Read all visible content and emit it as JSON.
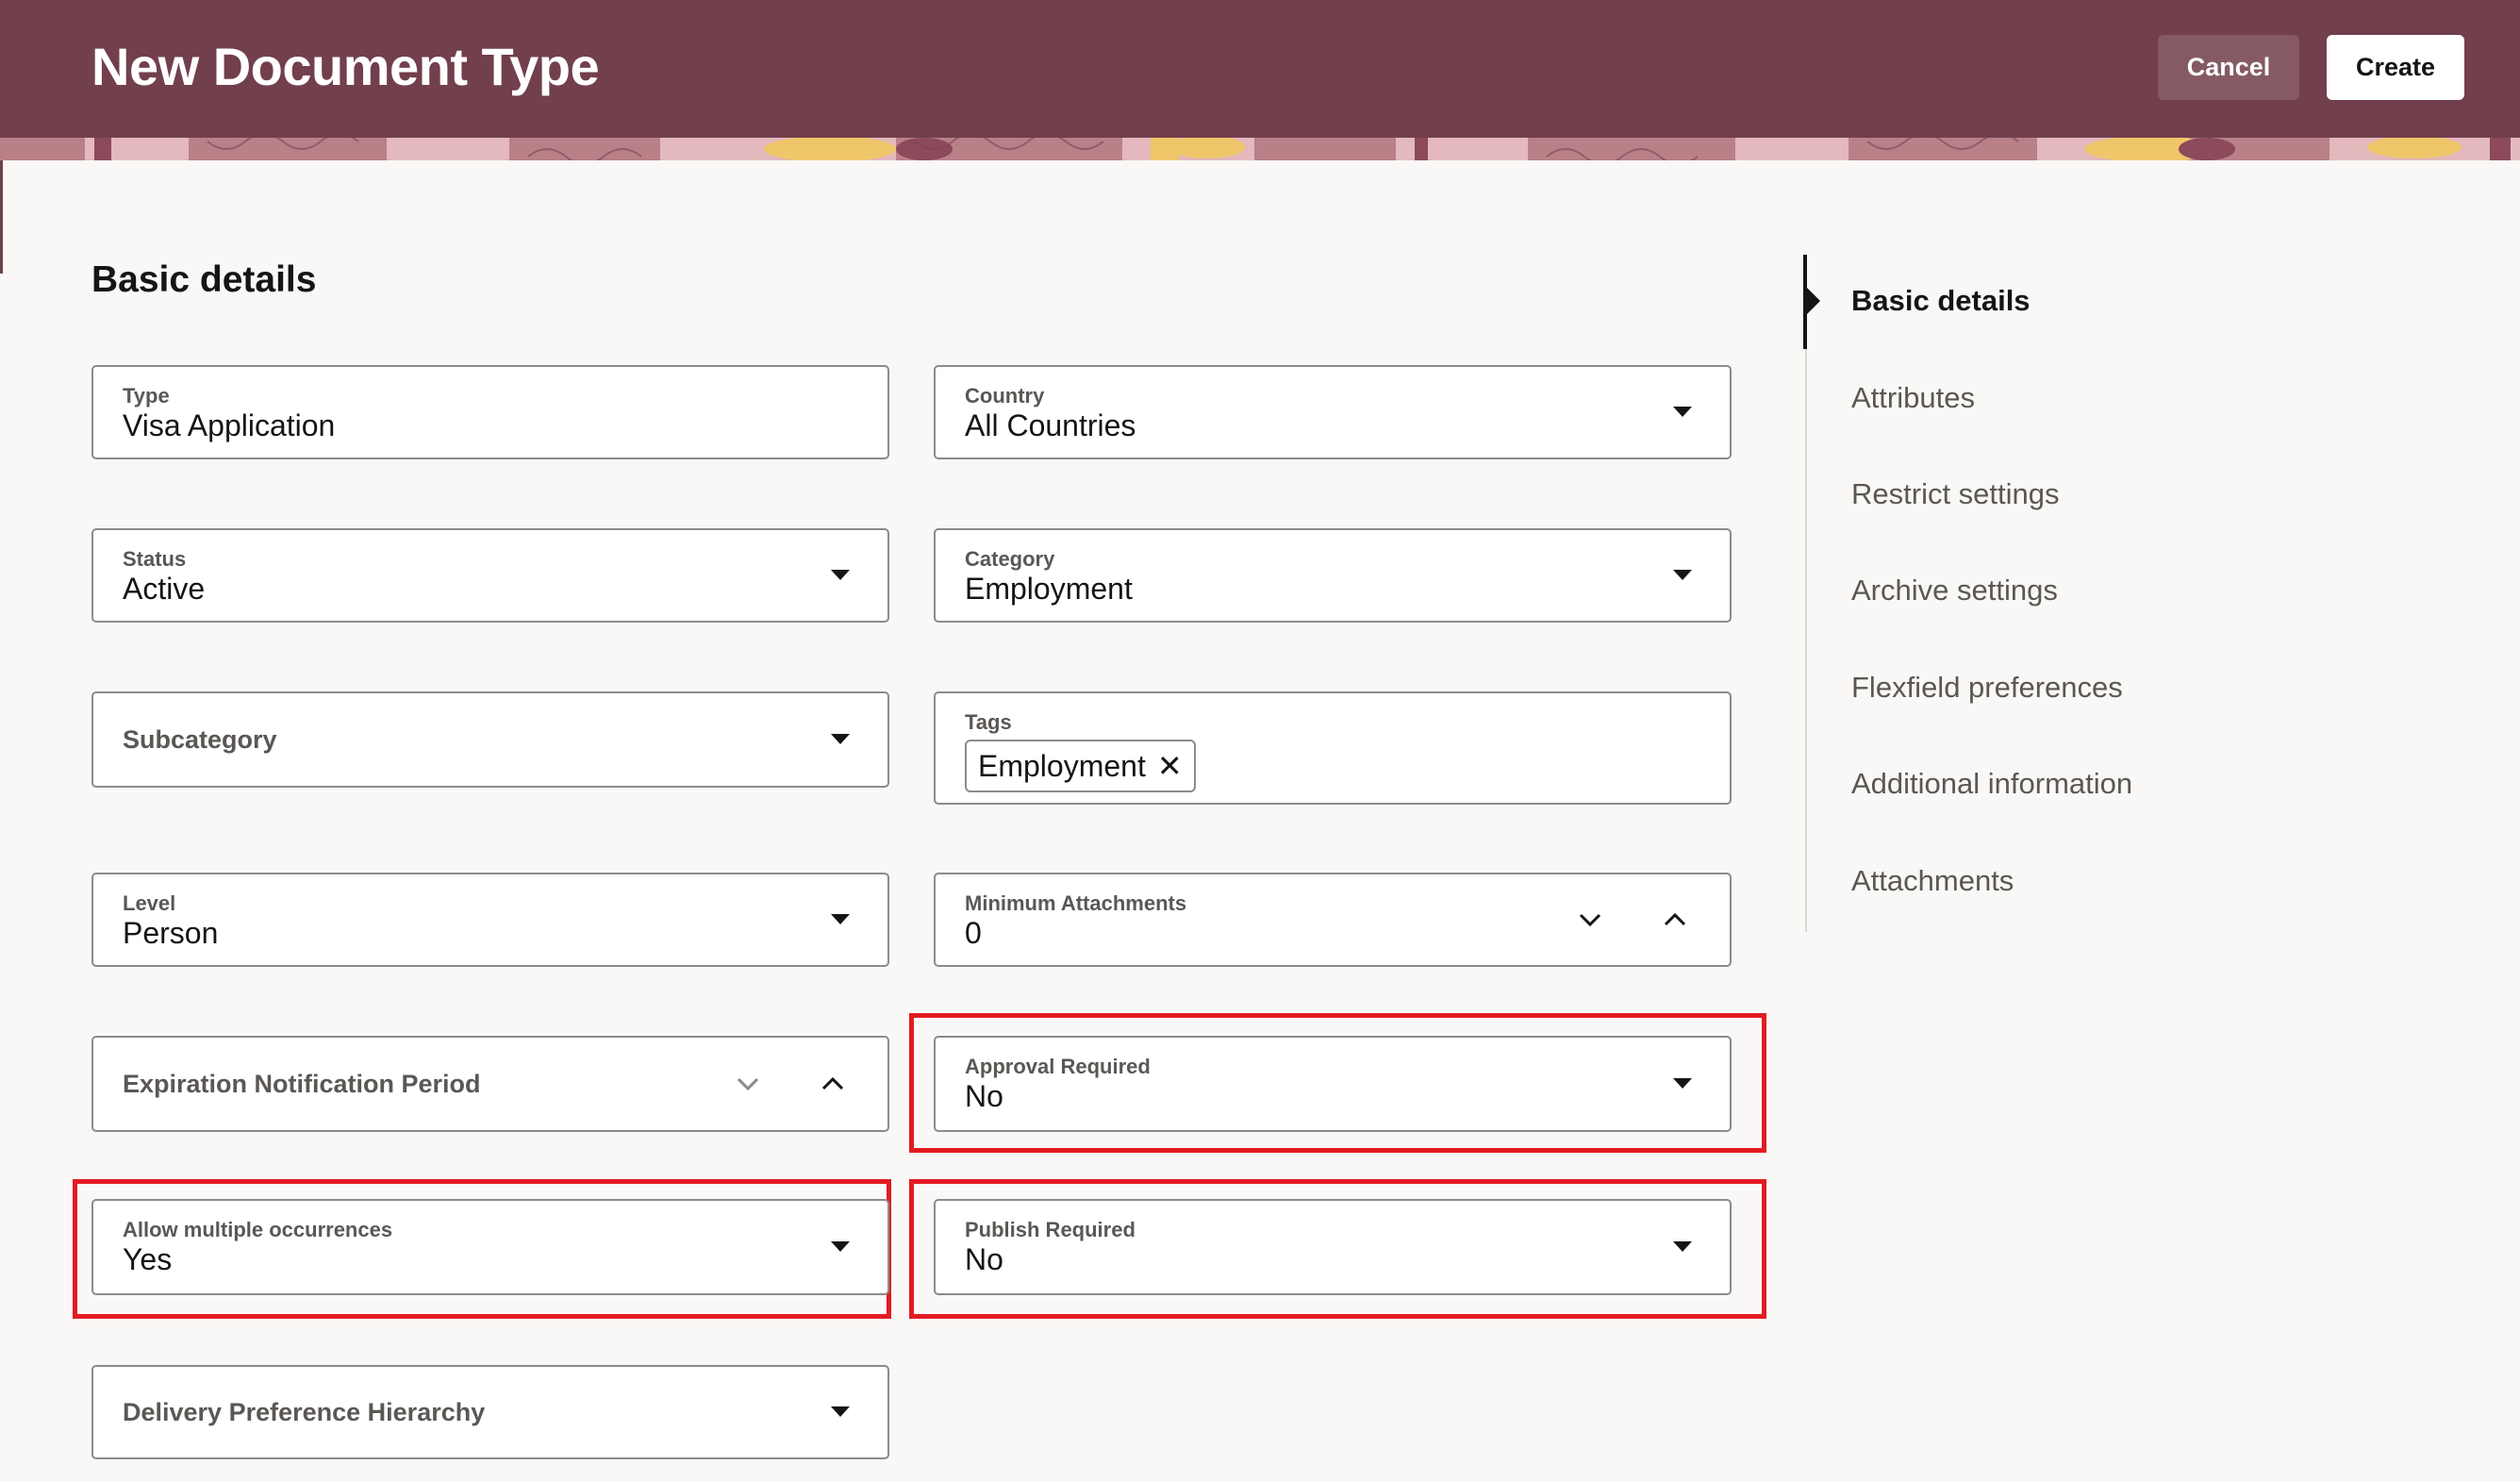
{
  "header": {
    "title": "New Document Type",
    "cancel_label": "Cancel",
    "create_label": "Create",
    "background_color": "#723f4c"
  },
  "section": {
    "title": "Basic details"
  },
  "fields": {
    "type": {
      "label": "Type",
      "value": "Visa Application"
    },
    "country": {
      "label": "Country",
      "value": "All Countries"
    },
    "status": {
      "label": "Status",
      "value": "Active"
    },
    "category": {
      "label": "Category",
      "value": "Employment"
    },
    "subcategory": {
      "label": "Subcategory",
      "value": ""
    },
    "tags": {
      "label": "Tags",
      "chips": [
        "Employment"
      ]
    },
    "level": {
      "label": "Level",
      "value": "Person"
    },
    "min_attachments": {
      "label": "Minimum Attachments",
      "value": "0"
    },
    "expiration_notification_period": {
      "label": "Expiration Notification Period",
      "value": ""
    },
    "approval_required": {
      "label": "Approval Required",
      "value": "No"
    },
    "allow_multiple_occurrences": {
      "label": "Allow multiple occurrences",
      "value": "Yes"
    },
    "publish_required": {
      "label": "Publish Required",
      "value": "No"
    },
    "delivery_preference_hierarchy": {
      "label": "Delivery Preference Hierarchy",
      "value": ""
    }
  },
  "nav": {
    "active": "Basic details",
    "items": [
      "Basic details",
      "Attributes",
      "Restrict settings",
      "Archive settings",
      "Flexfield preferences",
      "Additional information",
      "Attachments"
    ]
  },
  "colors": {
    "highlight": "#e31b23"
  }
}
